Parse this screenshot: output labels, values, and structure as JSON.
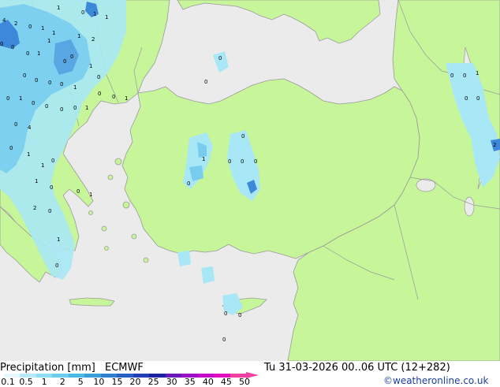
{
  "legend": {
    "title": "Precipitation [mm]",
    "model": "ECMWF",
    "datetime": "Tu 31-03-2026 00..06 UTC (12+282)",
    "credit": "©weatheronline.co.uk",
    "ticks": [
      "0.1",
      "0.5",
      "1",
      "2",
      "5",
      "10",
      "15",
      "20",
      "25",
      "30",
      "35",
      "40",
      "45",
      "50"
    ],
    "colors": [
      "#e6f7ff",
      "#b8e9fb",
      "#8fdcf5",
      "#6ccdef",
      "#4ab9e6",
      "#3a9fd9",
      "#2f7fd0",
      "#2a5fc4",
      "#2240b6",
      "#1a22a0",
      "#6a18b8",
      "#9a10c8",
      "#c40cc8",
      "#e010c0",
      "#f040a0"
    ]
  },
  "map": {
    "colors": {
      "sea": "#ebebeb",
      "land": "#c6f59a",
      "border": "#9a9a9a",
      "rain_light": "#a8e8f6",
      "rain_mid": "#78cdee",
      "rain_heavy": "#3d88d8"
    },
    "values": [
      {
        "t": "1"
      },
      {
        "t": "0"
      },
      {
        "t": "1"
      },
      {
        "t": "1"
      },
      {
        "t": "4"
      },
      {
        "t": "2"
      },
      {
        "t": "0"
      },
      {
        "t": "1"
      },
      {
        "t": "1"
      },
      {
        "t": "2"
      },
      {
        "t": "1"
      },
      {
        "t": "1"
      },
      {
        "t": "0"
      },
      {
        "t": "0"
      },
      {
        "t": "0"
      },
      {
        "t": "1"
      },
      {
        "t": "0"
      },
      {
        "t": "0"
      },
      {
        "t": "1"
      },
      {
        "t": "0"
      },
      {
        "t": "0"
      },
      {
        "t": "0"
      },
      {
        "t": "0"
      },
      {
        "t": "1"
      },
      {
        "t": "0"
      },
      {
        "t": "1"
      },
      {
        "t": "0"
      },
      {
        "t": "0"
      },
      {
        "t": "0"
      },
      {
        "t": "0"
      },
      {
        "t": "1"
      },
      {
        "t": "0"
      },
      {
        "t": "0"
      },
      {
        "t": "1"
      },
      {
        "t": "0"
      },
      {
        "t": "4"
      },
      {
        "t": "0"
      },
      {
        "t": "1"
      },
      {
        "t": "0"
      },
      {
        "t": "1"
      },
      {
        "t": "1"
      },
      {
        "t": "0"
      },
      {
        "t": "2"
      },
      {
        "t": "0"
      },
      {
        "t": "1"
      },
      {
        "t": "0"
      },
      {
        "t": "0"
      },
      {
        "t": "1"
      },
      {
        "t": "0"
      },
      {
        "t": "0"
      },
      {
        "t": "0"
      },
      {
        "t": "1"
      },
      {
        "t": "0"
      },
      {
        "t": "0"
      },
      {
        "t": "0"
      },
      {
        "t": "0"
      },
      {
        "t": "0"
      },
      {
        "t": "0"
      },
      {
        "t": "0"
      },
      {
        "t": "0"
      },
      {
        "t": "1"
      },
      {
        "t": "0"
      },
      {
        "t": "0"
      },
      {
        "t": "0"
      },
      {
        "t": "0"
      },
      {
        "t": "2"
      }
    ]
  }
}
